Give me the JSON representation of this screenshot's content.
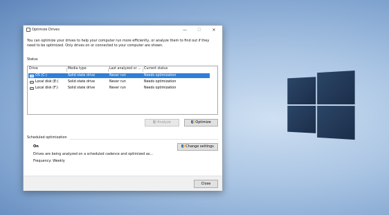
{
  "window": {
    "title": "Optimize Drives",
    "controls": {
      "minimize": "—",
      "maximize": "☐",
      "close": "✕"
    }
  },
  "intro_text": "You can optimize your drives to help your computer run more efficiently, or analyze them to find out if they need to be optimized. Only drives on or connected to your computer are shown.",
  "status": {
    "label": "Status",
    "columns": [
      "Drive",
      "Media type",
      "Last analyzed or ...",
      "Current status"
    ],
    "drives": [
      {
        "drive": "OS (C:)",
        "media_type": "Solid state drive",
        "last_analyzed": "Never run",
        "status": "Needs optimization",
        "selected": true
      },
      {
        "drive": "Local disk (E:)",
        "media_type": "Solid state drive",
        "last_analyzed": "Never run",
        "status": "Needs optimization",
        "selected": false
      },
      {
        "drive": "Local disk (F:)",
        "media_type": "Solid state drive",
        "last_analyzed": "Never run",
        "status": "Needs optimization",
        "selected": false
      }
    ]
  },
  "buttons": {
    "analyze": "Analyze",
    "optimize": "Optimize",
    "change_settings": "Change settings",
    "close": "Close"
  },
  "scheduled": {
    "label": "Scheduled optimization",
    "state": "On",
    "description": "Drives are being analyzed on a scheduled cadence and optimized as...",
    "frequency": "Frequency: Weekly"
  },
  "colors": {
    "selection": "#2f7fd8",
    "desktop_logo": "#1f3552"
  }
}
